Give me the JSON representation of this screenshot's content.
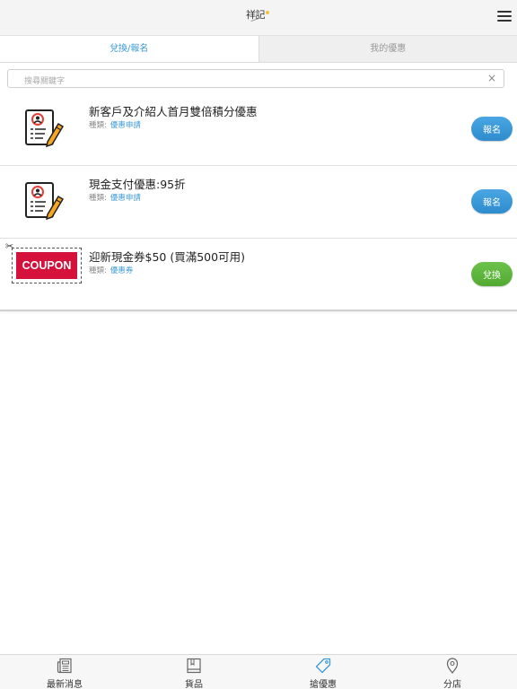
{
  "header": {
    "logo_text": "祥記",
    "menu_icon": "hamburger-menu-icon"
  },
  "tabs": [
    {
      "label": "兌換/報名",
      "active": true
    },
    {
      "label": "我的優惠",
      "active": false
    }
  ],
  "search": {
    "placeholder": "搜尋關鍵字",
    "value": "",
    "clear_icon": "×"
  },
  "items": [
    {
      "title": "新客戶及介紹人首月雙倍積分優惠",
      "category_label": "種類:",
      "category": "優惠申請",
      "action_label": "報名",
      "icon": "application-form-icon"
    },
    {
      "title": "現金支付優惠:95折",
      "category_label": "種類:",
      "category": "優惠申請",
      "action_label": "報名",
      "icon": "application-form-icon"
    },
    {
      "title": "迎新現金券$50 (買滿500可用)",
      "category_label": "種類:",
      "category": "優惠券",
      "action_label": "兌換",
      "icon": "coupon-icon",
      "coupon_text": "COUPON"
    }
  ],
  "bottom_nav": [
    {
      "label": "最新消息",
      "icon": "news-icon",
      "active": false
    },
    {
      "label": "貨品",
      "icon": "book-icon",
      "active": false
    },
    {
      "label": "搶優惠",
      "icon": "tag-icon",
      "active": true
    },
    {
      "label": "分店",
      "icon": "location-pin-icon",
      "active": false
    }
  ],
  "colors": {
    "accent_blue": "#3d9bd7",
    "button_blue": "#2f8ccd",
    "button_green": "#52aa33",
    "coupon_red": "#d4123c"
  }
}
